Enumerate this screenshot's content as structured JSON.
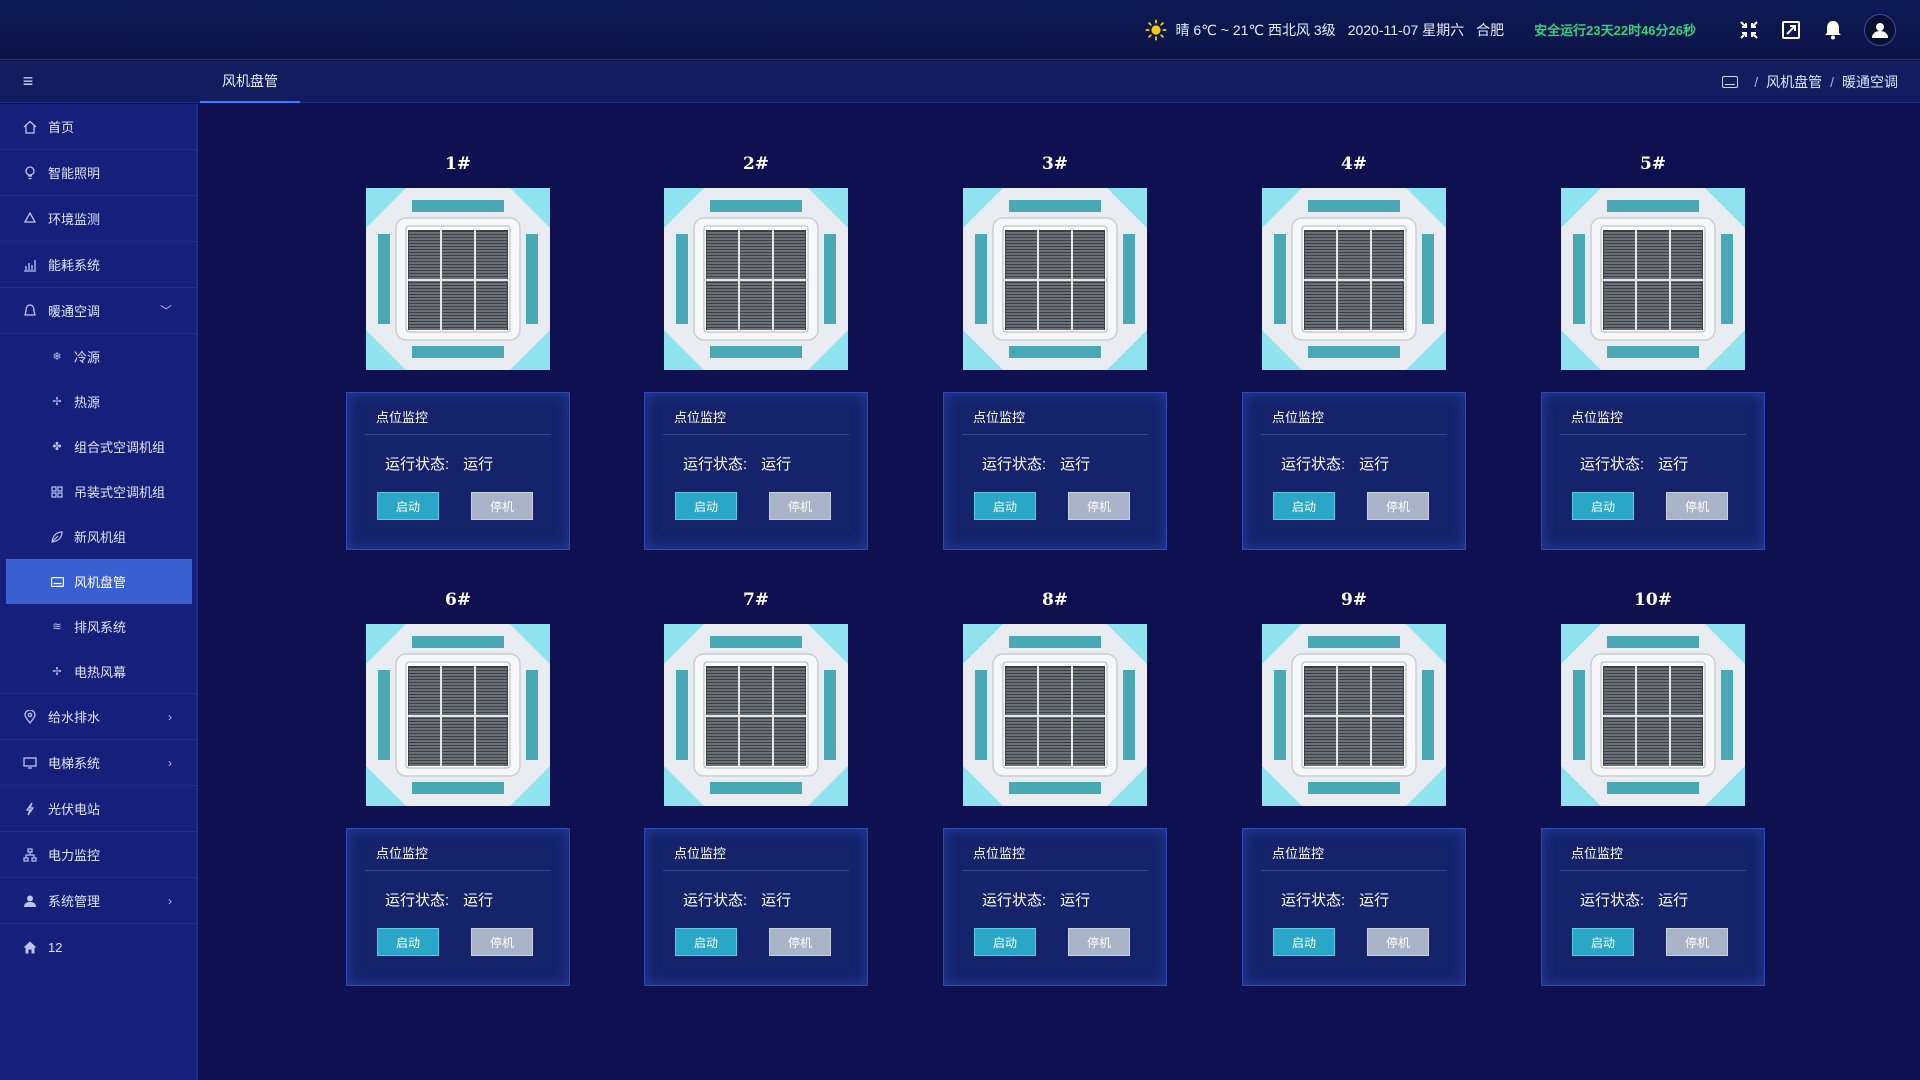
{
  "header": {
    "weather": "晴 6℃ ~ 21℃ 西北风 3级",
    "date": "2020-11-07 星期六",
    "city": "合肥",
    "safe_run": "安全运行23天22时46分26秒",
    "icons": [
      "sun-icon",
      "compress-icon",
      "expand-icon",
      "bell-icon",
      "user-icon"
    ]
  },
  "tabs": [
    {
      "label": "风机盘管"
    }
  ],
  "breadcrumb": {
    "items": [
      "风机盘管",
      "暖通空调"
    ]
  },
  "sidebar": {
    "items": [
      {
        "label": "首页",
        "icon": "home-outline-icon"
      },
      {
        "label": "智能照明",
        "icon": "bulb-icon"
      },
      {
        "label": "环境监测",
        "icon": "recycle-icon"
      },
      {
        "label": "能耗系统",
        "icon": "chart-icon"
      },
      {
        "label": "暖通空调",
        "icon": "bell-outline-icon",
        "expanded": true
      },
      {
        "label": "给水排水",
        "icon": "location-icon"
      },
      {
        "label": "电梯系统",
        "icon": "monitor-icon"
      },
      {
        "label": "光伏电站",
        "icon": "bolt-icon"
      },
      {
        "label": "电力监控",
        "icon": "network-icon"
      },
      {
        "label": "系统管理",
        "icon": "person-icon"
      },
      {
        "label": "12",
        "icon": "home-solid-icon"
      }
    ],
    "sub_items": [
      {
        "label": "冷源",
        "icon": "snowflake-icon"
      },
      {
        "label": "热源",
        "icon": "fan-icon"
      },
      {
        "label": "组合式空调机组",
        "icon": "fan-icon"
      },
      {
        "label": "吊装式空调机组",
        "icon": "grid-icon"
      },
      {
        "label": "新风机组",
        "icon": "leaf-icon"
      },
      {
        "label": "风机盘管",
        "icon": "ac-icon",
        "active": true
      },
      {
        "label": "排风系统",
        "icon": "wind-icon"
      },
      {
        "label": "电热风幕",
        "icon": "fan-icon"
      }
    ]
  },
  "panel": {
    "head": "点位监控",
    "status_label": "运行状态:",
    "start_label": "启动",
    "stop_label": "停机"
  },
  "units": [
    {
      "title": "1#",
      "status": "运行"
    },
    {
      "title": "2#",
      "status": "运行"
    },
    {
      "title": "3#",
      "status": "运行"
    },
    {
      "title": "4#",
      "status": "运行"
    },
    {
      "title": "5#",
      "status": "运行"
    },
    {
      "title": "6#",
      "status": "运行"
    },
    {
      "title": "7#",
      "status": "运行"
    },
    {
      "title": "8#",
      "status": "运行"
    },
    {
      "title": "9#",
      "status": "运行"
    },
    {
      "title": "10#",
      "status": "运行"
    }
  ]
}
